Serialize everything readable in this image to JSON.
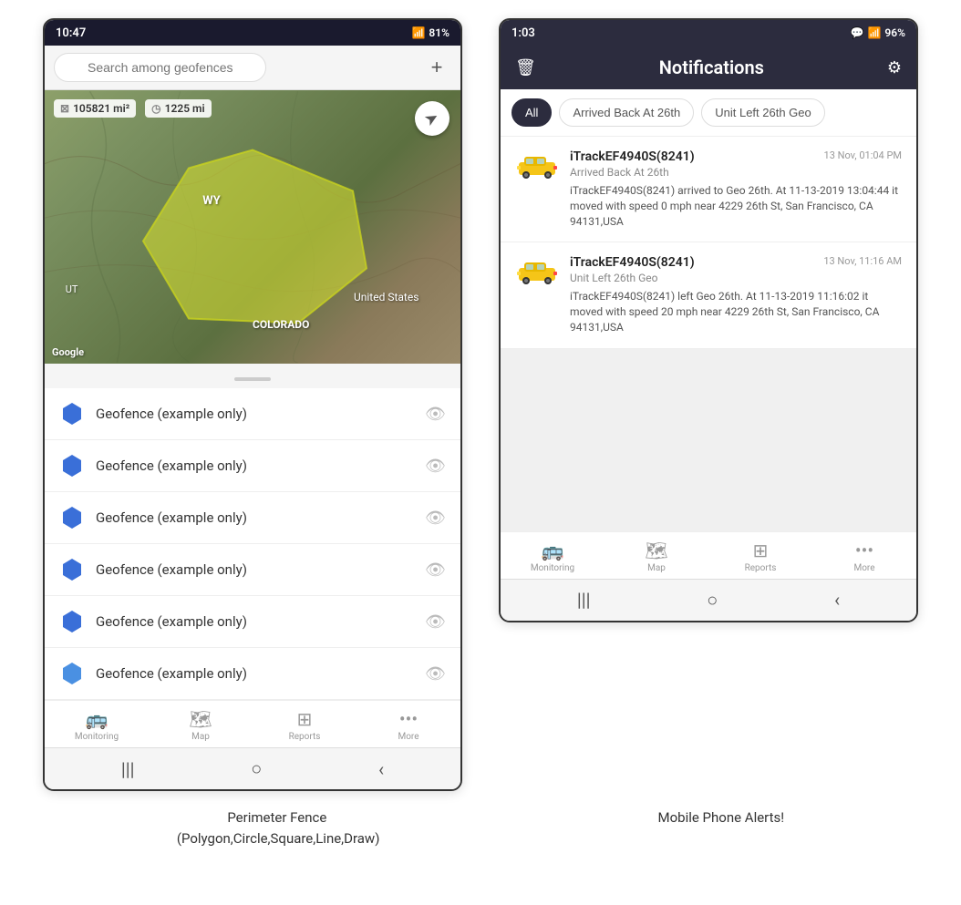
{
  "left_phone": {
    "status_bar": {
      "time": "10:47",
      "signal": "▲",
      "wifi": "WiFi",
      "battery": "81%"
    },
    "search": {
      "placeholder": "Search among geofences"
    },
    "map": {
      "stat1": "105821 mi²",
      "stat2": "1225 mi",
      "label_wy": "WY",
      "label_us": "United States",
      "label_co": "COLORADO",
      "label_ut": "UT",
      "google": "Google"
    },
    "geo_items": [
      {
        "name": "Geofence (example only)"
      },
      {
        "name": "Geofence (example only)"
      },
      {
        "name": "Geofence (example only)"
      },
      {
        "name": "Geofence (example only)"
      },
      {
        "name": "Geofence (example only)"
      },
      {
        "name": "Geofence (example only)"
      }
    ],
    "nav": [
      {
        "label": "Monitoring"
      },
      {
        "label": "Map"
      },
      {
        "label": "Reports"
      },
      {
        "label": "More"
      }
    ]
  },
  "right_phone": {
    "status_bar": {
      "time": "1:03",
      "battery": "96%"
    },
    "header": {
      "title": "Notifications"
    },
    "filter_tabs": [
      {
        "label": "All",
        "active": true
      },
      {
        "label": "Arrived Back At 26th",
        "active": false
      },
      {
        "label": "Unit Left 26th Geo",
        "active": false
      }
    ],
    "notifications": [
      {
        "device": "iTrackEF4940S(8241)",
        "time": "13 Nov, 01:04 PM",
        "event": "Arrived Back At 26th",
        "body": "iTrackEF4940S(8241) arrived to Geo 26th.   At 11-13-2019 13:04:44 it moved with speed 0 mph near 4229 26th St, San Francisco, CA 94131,USA"
      },
      {
        "device": "iTrackEF4940S(8241)",
        "time": "13 Nov, 11:16 AM",
        "event": "Unit Left 26th Geo",
        "body": "iTrackEF4940S(8241) left Geo 26th.   At 11-13-2019 11:16:02 it moved with speed 20 mph near 4229 26th St, San Francisco, CA 94131,USA"
      }
    ],
    "nav": [
      {
        "label": "Monitoring"
      },
      {
        "label": "Map"
      },
      {
        "label": "Reports"
      },
      {
        "label": "More"
      }
    ]
  },
  "captions": {
    "left": "Perimeter Fence\n(Polygon,Circle,Square,Line,Draw)",
    "right": "Mobile Phone Alerts!"
  },
  "icons": {
    "search": "🔍",
    "add": "+",
    "compass": "➤",
    "eye_off": "👁",
    "monitoring": "🚌",
    "map": "🗺",
    "reports": "📊",
    "more": "•••",
    "trash": "🗑",
    "settings": "⚙",
    "back": "‹",
    "home": "○",
    "menu": "|||"
  }
}
